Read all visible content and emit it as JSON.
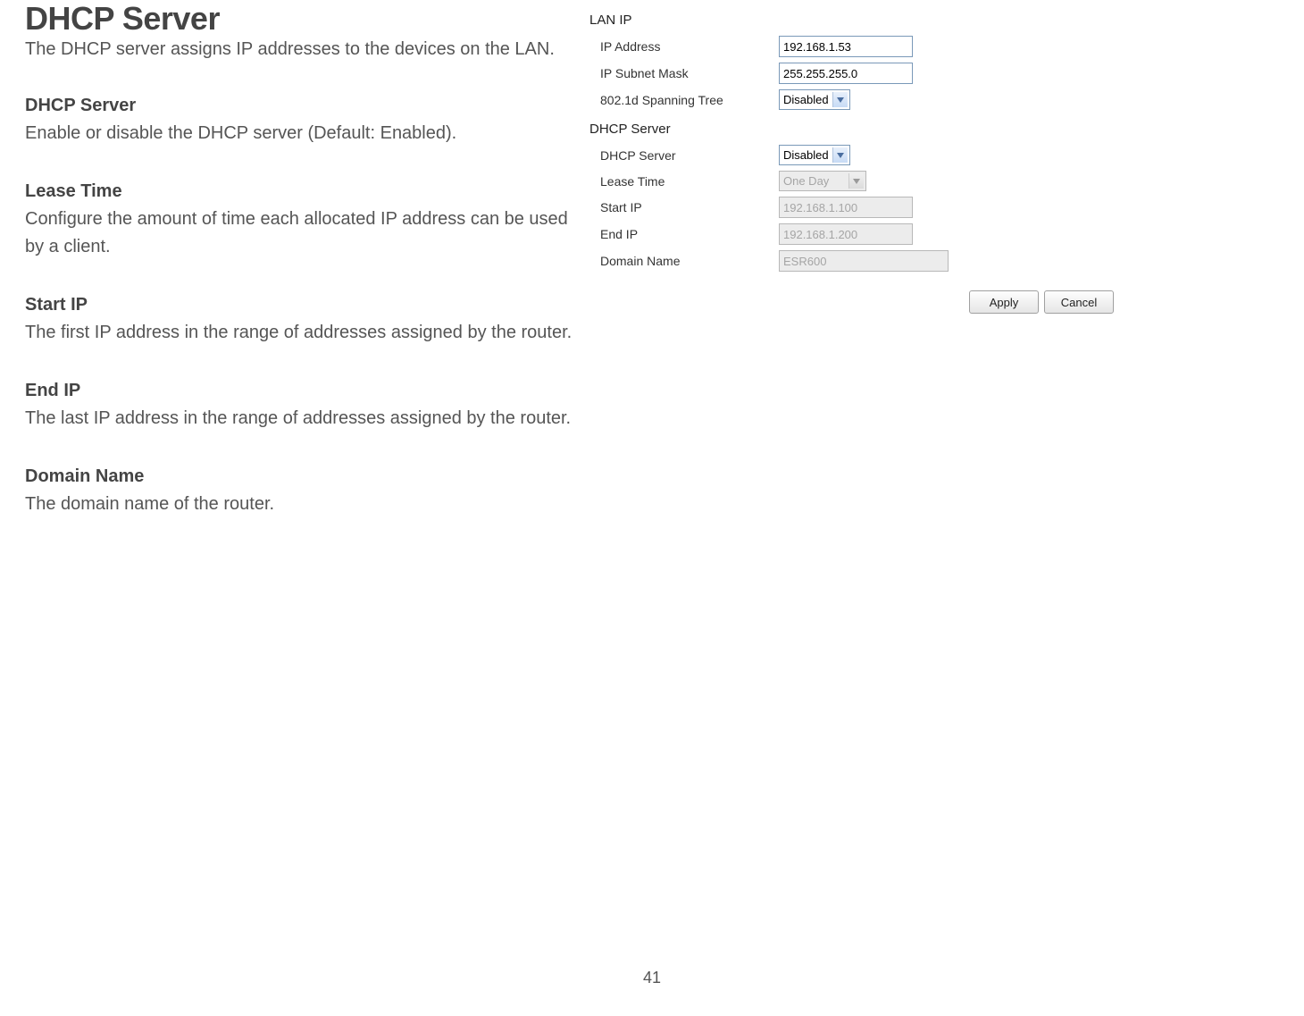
{
  "page": {
    "title": "DHCP Server",
    "intro": "The DHCP server assigns IP addresses to the devices on the LAN.",
    "number": "41"
  },
  "sections": {
    "dhcp_server": {
      "heading": "DHCP Server",
      "body": "Enable or disable the DHCP server (Default: Enabled)."
    },
    "lease_time": {
      "heading": "Lease Time",
      "body": "Configure the amount of time each allocated IP address can be used by a client."
    },
    "start_ip": {
      "heading": "Start IP",
      "body": "The first IP address in the range of addresses assigned by the router."
    },
    "end_ip": {
      "heading": "End IP",
      "body": "The last IP address in the range of addresses assigned by the router."
    },
    "domain_name": {
      "heading": "Domain Name",
      "body": "The domain name of the router."
    }
  },
  "panel": {
    "lan_ip": {
      "title": "LAN IP",
      "ip_address_label": "IP Address",
      "ip_address_value": "192.168.1.53",
      "subnet_label": "IP Subnet Mask",
      "subnet_value": "255.255.255.0",
      "spanning_label": "802.1d Spanning Tree",
      "spanning_value": "Disabled"
    },
    "dhcp": {
      "title": "DHCP Server",
      "server_label": "DHCP Server",
      "server_value": "Disabled",
      "lease_label": "Lease Time",
      "lease_value": "One Day",
      "start_label": "Start IP",
      "start_value": "192.168.1.100",
      "end_label": "End IP",
      "end_value": "192.168.1.200",
      "domain_label": "Domain Name",
      "domain_value": "ESR600"
    },
    "buttons": {
      "apply": "Apply",
      "cancel": "Cancel"
    }
  }
}
